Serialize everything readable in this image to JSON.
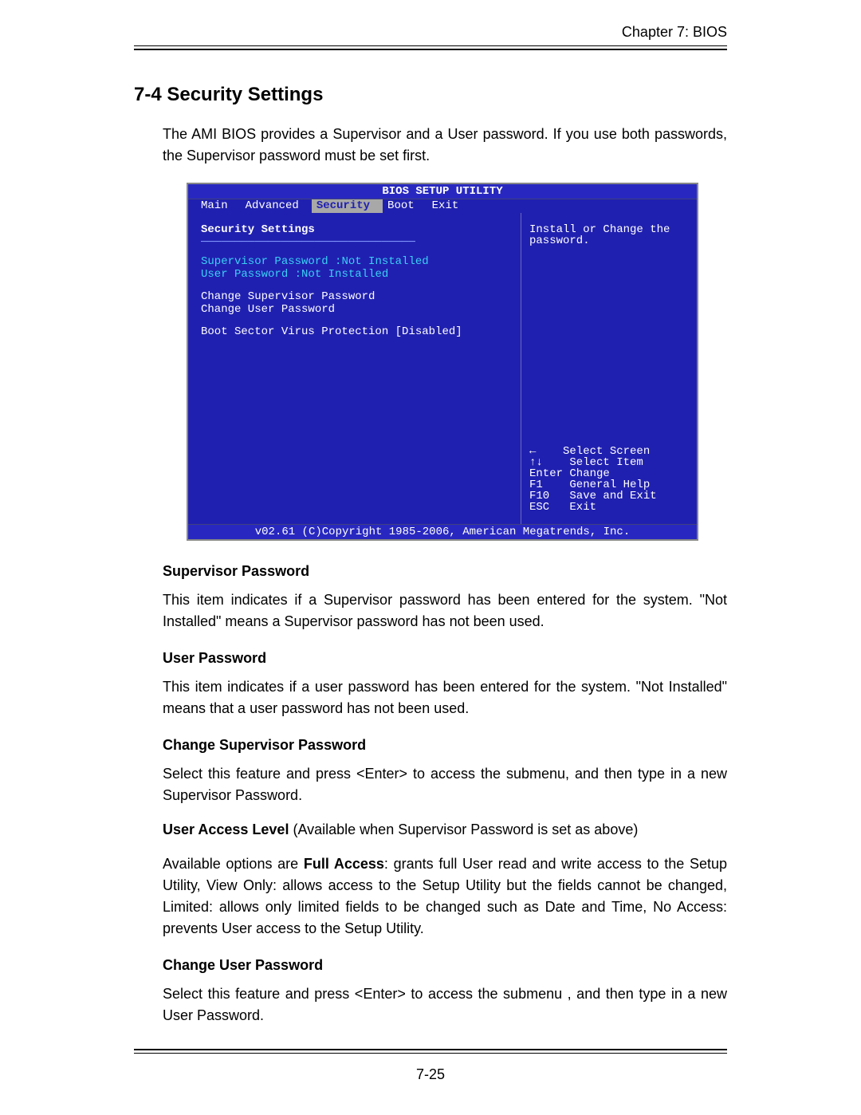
{
  "chapter": "Chapter 7: BIOS",
  "section_heading": "7-4   Security Settings",
  "intro": "The AMI BIOS provides a Supervisor and a User password. If you use both passwords, the Supervisor password must be set first.",
  "bios": {
    "title": "BIOS SETUP UTILITY",
    "tabs": [
      "Main",
      "Advanced",
      "Security",
      "Boot",
      "Exit"
    ],
    "active_tab": "Security",
    "left_title": "Security Settings",
    "supervisor_label": "Supervisor Password :",
    "supervisor_value": "Not Installed",
    "user_label": "User Password       :",
    "user_value": "Not Installed",
    "change_supervisor": "Change Supervisor Password",
    "change_user": "Change User Password",
    "boot_sector_label": "Boot Sector Virus Protection   ",
    "boot_sector_value": "[Disabled]",
    "help_top1": "Install or Change the",
    "help_top2": "password.",
    "keys": {
      "arrow_lr": "←    Select Screen",
      "arrow_ud": "↑↓    Select Item",
      "enter": "Enter Change",
      "f1": "F1    General Help",
      "f10": "F10   Save and Exit",
      "esc": "ESC   Exit"
    },
    "footer": "v02.61 (C)Copyright 1985-2006, American Megatrends, Inc."
  },
  "body": {
    "h_supervisor": "Supervisor Password",
    "p_supervisor": "This item indicates if a Supervisor password has been entered for the system. \"Not Installed\" means a Supervisor password has not been used.",
    "h_user": "User Password",
    "p_user": "This item indicates if a user password has been entered for the system. \"Not Installed\" means that a user password has not been used.",
    "h_change_sup": "Change Supervisor Password",
    "p_change_sup": "Select this feature and press <Enter> to access the submenu, and then type in a new Supervisor Password.",
    "ual_bold": "User Access Level",
    "ual_rest": " (Available when Supervisor Password is set as above)",
    "p_options_pre": "Available options are ",
    "p_options_bold": "Full Access",
    "p_options_post": ": grants full User read and write access to the Setup Utility, View Only: allows access to the Setup Utility but the fields cannot be changed, Limited: allows only limited fields to be changed such as Date and Time, No Access: prevents User access to the Setup Utility.",
    "h_change_user": "Change User Password",
    "p_change_user": "Select this feature and press <Enter> to access the submenu , and then type in a new User Password."
  },
  "page_number": "7-25"
}
